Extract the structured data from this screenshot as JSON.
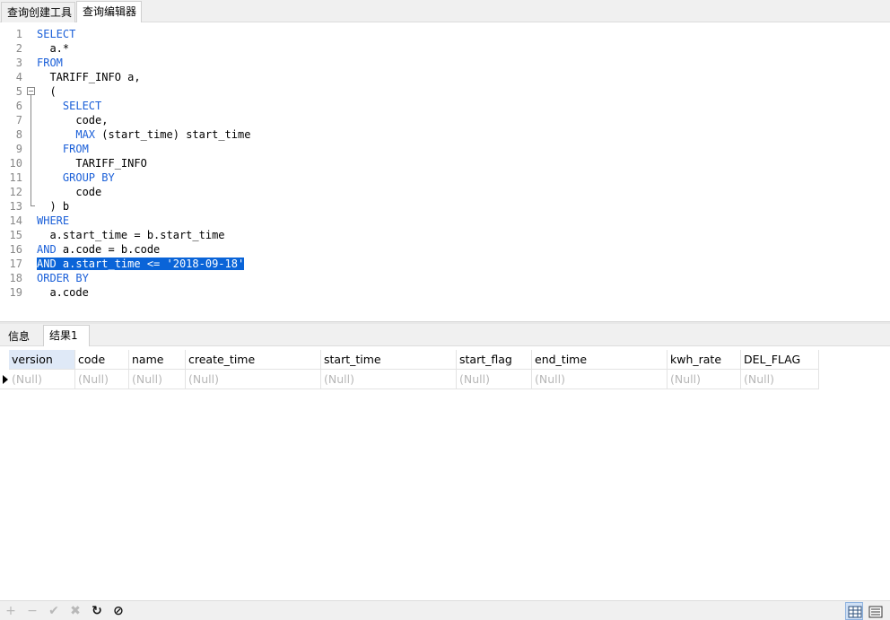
{
  "tabs": {
    "query_builder": "查询创建工具",
    "query_editor": "查询编辑器"
  },
  "editor": {
    "lines": [
      {
        "n": "1",
        "parts": [
          {
            "t": "SELECT",
            "k": true
          }
        ]
      },
      {
        "n": "2",
        "parts": [
          {
            "t": "  a.*",
            "k": false
          }
        ]
      },
      {
        "n": "3",
        "parts": [
          {
            "t": "FROM",
            "k": true
          }
        ]
      },
      {
        "n": "4",
        "parts": [
          {
            "t": "  TARIFF_INFO a,",
            "k": false
          }
        ]
      },
      {
        "n": "5",
        "parts": [
          {
            "t": "  (",
            "k": false
          }
        ]
      },
      {
        "n": "6",
        "parts": [
          {
            "t": "    ",
            "k": false
          },
          {
            "t": "SELECT",
            "k": true
          }
        ]
      },
      {
        "n": "7",
        "parts": [
          {
            "t": "      code,",
            "k": false
          }
        ]
      },
      {
        "n": "8",
        "parts": [
          {
            "t": "      ",
            "k": false
          },
          {
            "t": "MAX",
            "k": true
          },
          {
            "t": " (start_time) start_time",
            "k": false
          }
        ]
      },
      {
        "n": "9",
        "parts": [
          {
            "t": "    ",
            "k": false
          },
          {
            "t": "FROM",
            "k": true
          }
        ]
      },
      {
        "n": "10",
        "parts": [
          {
            "t": "      TARIFF_INFO",
            "k": false
          }
        ]
      },
      {
        "n": "11",
        "parts": [
          {
            "t": "    ",
            "k": false
          },
          {
            "t": "GROUP BY",
            "k": true
          }
        ]
      },
      {
        "n": "12",
        "parts": [
          {
            "t": "      code",
            "k": false
          }
        ]
      },
      {
        "n": "13",
        "parts": [
          {
            "t": "  ) b",
            "k": false
          }
        ]
      },
      {
        "n": "14",
        "parts": [
          {
            "t": "WHERE",
            "k": true
          }
        ]
      },
      {
        "n": "15",
        "parts": [
          {
            "t": "  a.start_time = b.start_time",
            "k": false
          }
        ]
      },
      {
        "n": "16",
        "parts": [
          {
            "t": "AND",
            "k": true
          },
          {
            "t": " a.code = b.code",
            "k": false
          }
        ]
      },
      {
        "n": "17",
        "parts": [
          {
            "t": "AND a.start_time <= '2018-09-18'",
            "k": false,
            "sel": true
          }
        ]
      },
      {
        "n": "18",
        "parts": [
          {
            "t": "ORDER BY",
            "k": true
          }
        ]
      },
      {
        "n": "19",
        "parts": [
          {
            "t": "  a.code",
            "k": false
          }
        ]
      }
    ]
  },
  "result_tabs": {
    "info": "信息",
    "result1": "结果1"
  },
  "grid": {
    "columns": [
      "version",
      "code",
      "name",
      "create_time",
      "start_time",
      "start_flag",
      "end_time",
      "kwh_rate",
      "DEL_FLAG"
    ],
    "rows": [
      [
        "(Null)",
        "(Null)",
        "(Null)",
        "(Null)",
        "(Null)",
        "(Null)",
        "(Null)",
        "(Null)",
        "(Null)"
      ]
    ]
  },
  "statusbar": {
    "add": "+",
    "remove": "−",
    "apply": "✔",
    "discard": "✖",
    "refresh": "↻",
    "stop": "⊘"
  }
}
